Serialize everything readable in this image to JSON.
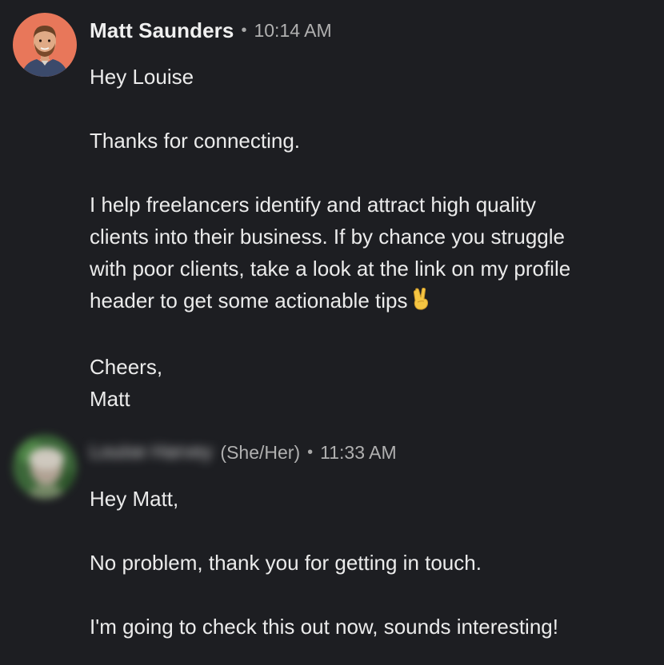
{
  "thread": {
    "messages": [
      {
        "sender_name": "Matt Saunders",
        "separator": "•",
        "time": "10:14 AM",
        "avatar_icon": "profile-photo-icon",
        "paragraphs": [
          [
            "Hey Louise"
          ],
          [
            "Thanks for connecting."
          ],
          [
            "I help freelancers identify and attract high quality",
            "clients into their business. If by chance you struggle",
            "with poor clients, take a look at the link on my profile",
            "header to get some actionable tips"
          ],
          [
            "Cheers,",
            "Matt"
          ]
        ],
        "emoji": "victory-hand-icon"
      },
      {
        "sender_name": "Louise Harvey",
        "pronouns": "(She/Her)",
        "separator": "•",
        "time": "11:33 AM",
        "avatar_icon": "blurred-profile-photo-icon",
        "paragraphs": [
          [
            "Hey Matt,"
          ],
          [
            "No problem, thank you for getting in touch."
          ],
          [
            "I'm going to check this out now, sounds interesting!"
          ]
        ]
      }
    ]
  },
  "colors": {
    "background": "#1d1e22",
    "text": "#ebebeb",
    "meta": "#b0b0b0",
    "avatar_bg": "#e8775a"
  }
}
